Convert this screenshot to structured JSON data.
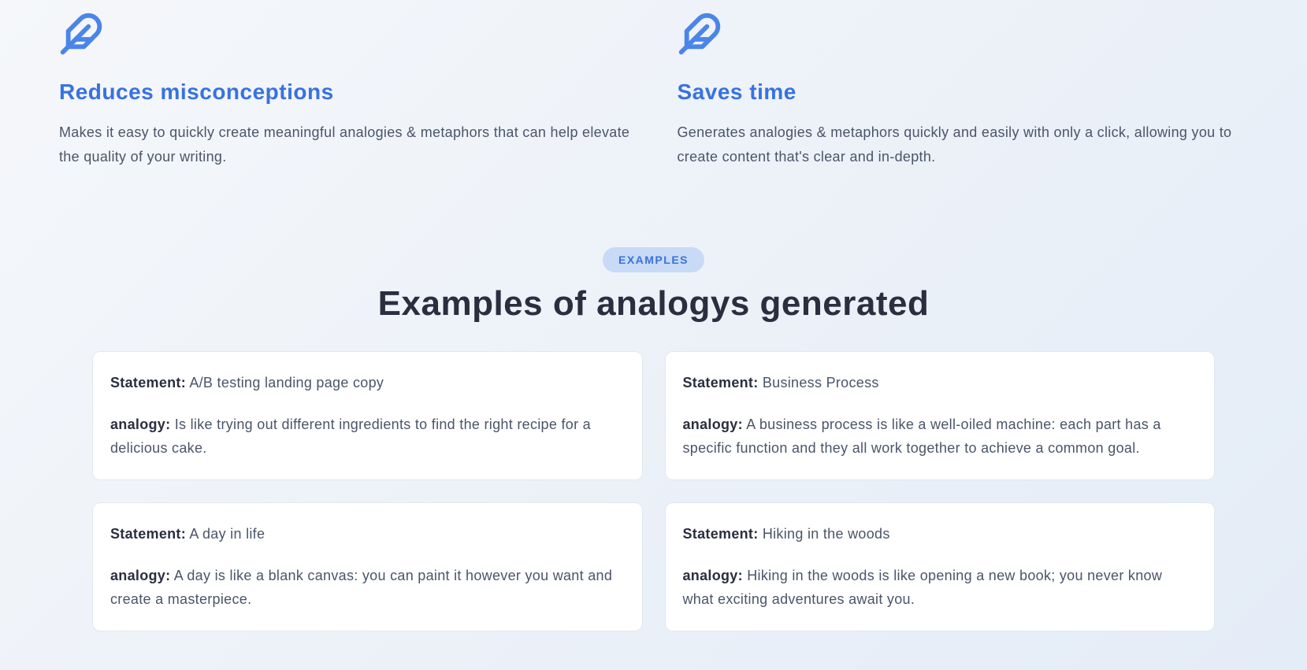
{
  "features": [
    {
      "title": "Reduces misconceptions",
      "description": "Makes it easy to quickly create meaningful analogies & metaphors that can help elevate the quality of your writing."
    },
    {
      "title": "Saves time",
      "description": "Generates analogies & metaphors quickly and easily with only a click, allowing you to create content that's clear and in-depth."
    }
  ],
  "examples": {
    "badge": "EXAMPLES",
    "title": "Examples of analogys generated",
    "labels": {
      "statement": "Statement:",
      "analogy": "analogy:"
    },
    "cards": [
      {
        "statement": "A/B testing landing page copy",
        "analogy": "Is like trying out different ingredients to find the right recipe for a delicious cake."
      },
      {
        "statement": "Business Process",
        "analogy": "A business process is like a well-oiled machine: each part has a specific function and they all work together to achieve a common goal."
      },
      {
        "statement": "A day in life",
        "analogy": "A day is like a blank canvas: you can paint it however you want and create a masterpiece."
      },
      {
        "statement": "Hiking in the woods",
        "analogy": "Hiking in the woods is like opening a new book; you never know what exciting adventures await you."
      }
    ]
  }
}
